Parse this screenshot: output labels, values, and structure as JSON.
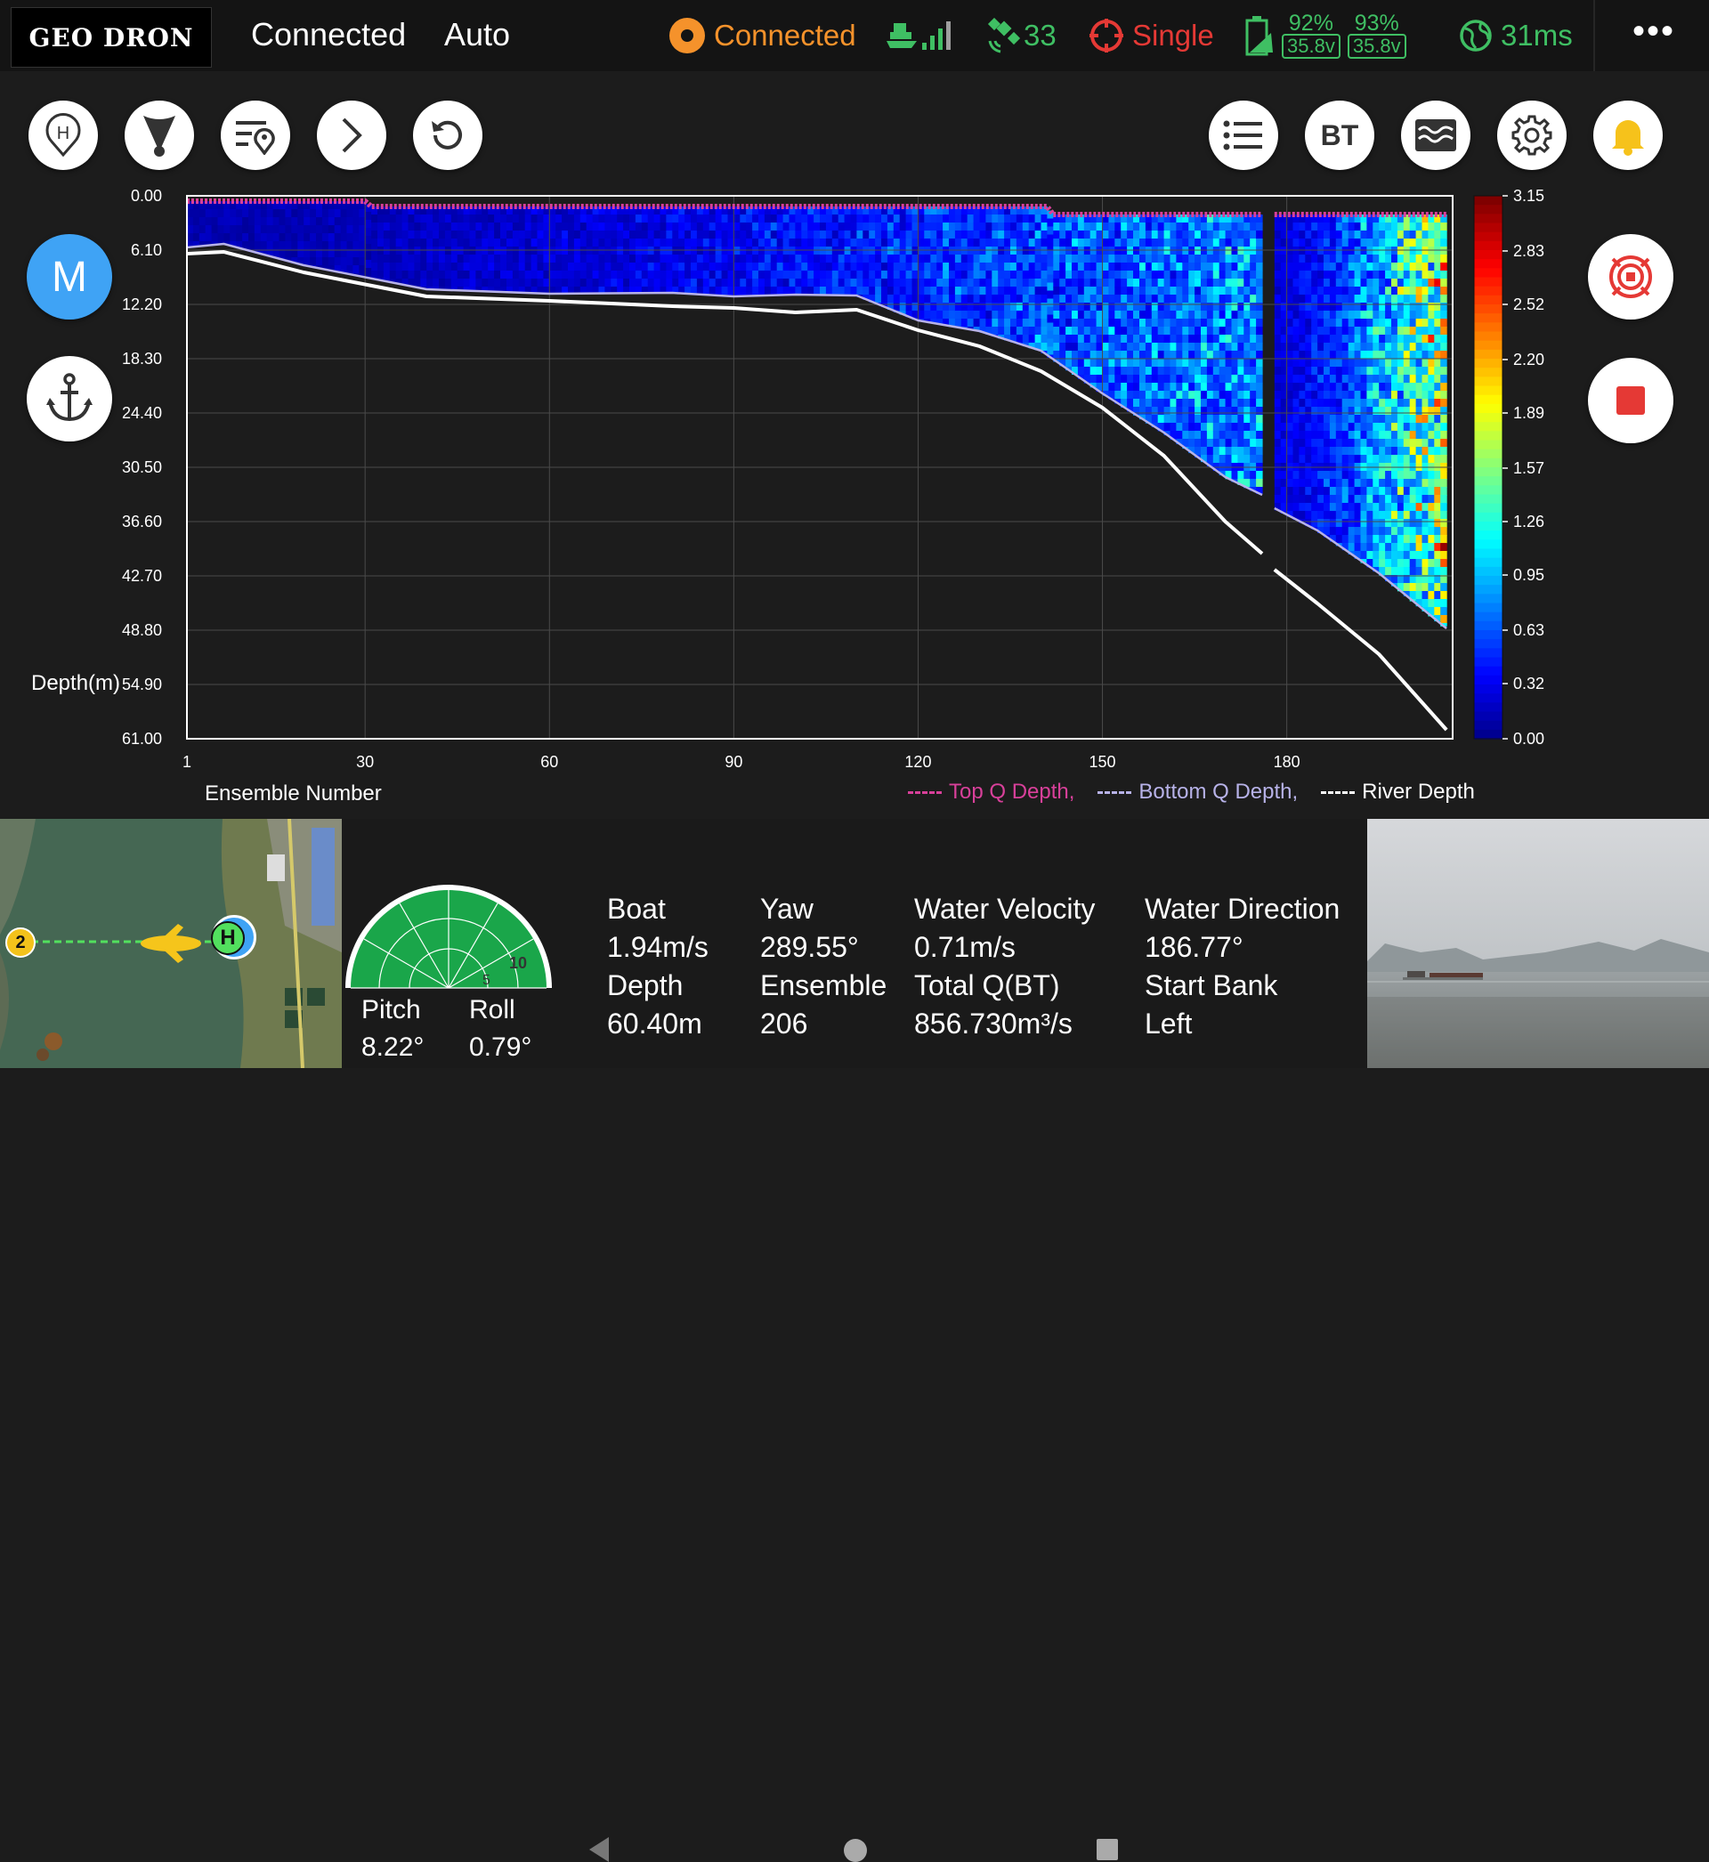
{
  "app": {
    "logo_text": "GEO DRON"
  },
  "topbar": {
    "connection": "Connected",
    "mode": "Auto",
    "link_status": "Connected",
    "satellites": "33",
    "rtk_mode": "Single",
    "battery1_pct": "92%",
    "battery1_volt": "35.8v",
    "battery2_pct": "93%",
    "battery2_volt": "35.8v",
    "latency": "31ms",
    "more_label": "•••"
  },
  "colors": {
    "accent_blue": "#3fa3f5",
    "status_green": "#3fbf63",
    "status_orange": "#f5922b",
    "status_red": "#e53935",
    "top_q": "#d8409a",
    "bottom_q": "#b7b2e8",
    "river": "#ffffff"
  },
  "left_buttons": {
    "mode_label": "M",
    "toolbar_bt_label": "BT"
  },
  "chart_data": {
    "type": "heatmap",
    "xlabel": "Ensemble Number",
    "ylabel": "Depth(m)",
    "x_ticks": [
      "1",
      "30",
      "60",
      "90",
      "120",
      "150",
      "180"
    ],
    "y_ticks": [
      "0.00",
      "6.10",
      "12.20",
      "18.30",
      "24.40",
      "30.50",
      "36.60",
      "42.70",
      "48.80",
      "54.90",
      "61.00"
    ],
    "xlim": [
      1,
      207
    ],
    "ylim": [
      0,
      61
    ],
    "colorbar_ticks": [
      "3.15",
      "2.83",
      "2.52",
      "2.20",
      "1.89",
      "1.57",
      "1.26",
      "0.95",
      "0.63",
      "0.32",
      "0.00"
    ],
    "colorbar_range": [
      0,
      3.15
    ],
    "grid": true,
    "legend_position": "bottom-right",
    "series": [
      {
        "name": "Top Q Depth,",
        "x": [
          1,
          30,
          31,
          141,
          142,
          176,
          178,
          206
        ],
        "y": [
          0.6,
          0.6,
          1.2,
          1.2,
          2.1,
          2.1,
          2.1,
          2.1
        ]
      },
      {
        "name": "Bottom Q Depth,",
        "x": [
          1,
          7,
          20,
          40,
          60,
          80,
          90,
          100,
          110,
          120,
          130,
          140,
          150,
          160,
          170,
          176,
          178,
          185,
          195,
          206
        ],
        "y": [
          5.8,
          5.4,
          7.8,
          10.5,
          11.0,
          10.9,
          11.3,
          11.1,
          11.2,
          14.0,
          15.2,
          17.4,
          22.2,
          26.6,
          31.6,
          33.6,
          35.1,
          37.6,
          42.4,
          48.6
        ]
      },
      {
        "name": "River Depth",
        "x": [
          1,
          7,
          20,
          40,
          60,
          80,
          90,
          100,
          110,
          120,
          130,
          140,
          150,
          160,
          170,
          176,
          178,
          185,
          195,
          206
        ],
        "y": [
          6.5,
          6.3,
          8.6,
          11.3,
          11.8,
          12.4,
          12.6,
          13.1,
          12.8,
          15.1,
          16.9,
          19.7,
          23.8,
          29.2,
          36.6,
          40.2,
          42.0,
          45.8,
          51.5,
          60.0
        ]
      }
    ],
    "heat_segments": [
      {
        "x_start": 1,
        "x_end": 176,
        "value_low": 0.15,
        "value_high": 1.1
      },
      {
        "x_start": 178,
        "x_end": 206,
        "value_low": 0.3,
        "value_high": 2.3
      }
    ]
  },
  "attitude": {
    "pitch_label": "Pitch",
    "pitch_value": "8.22°",
    "roll_label": "Roll",
    "roll_value": "0.79°",
    "radar_ring_5": "5",
    "radar_ring_10": "10"
  },
  "telemetry": {
    "boat_label": "Boat",
    "boat_value": "1.94m/s",
    "depth_label": "Depth",
    "depth_value": "60.40m",
    "yaw_label": "Yaw",
    "yaw_value": "289.55°",
    "ensemble_label": "Ensemble",
    "ensemble_value": "206",
    "water_velocity_label": "Water Velocity",
    "water_velocity_value": "0.71m/s",
    "total_q_label": "Total Q(BT)",
    "total_q_value": "856.730m³/s",
    "water_direction_label": "Water Direction",
    "water_direction_value": "186.77°",
    "start_bank_label": "Start Bank",
    "start_bank_value": "Left"
  },
  "map": {
    "waypoint_label": "2",
    "home_label": "H"
  }
}
